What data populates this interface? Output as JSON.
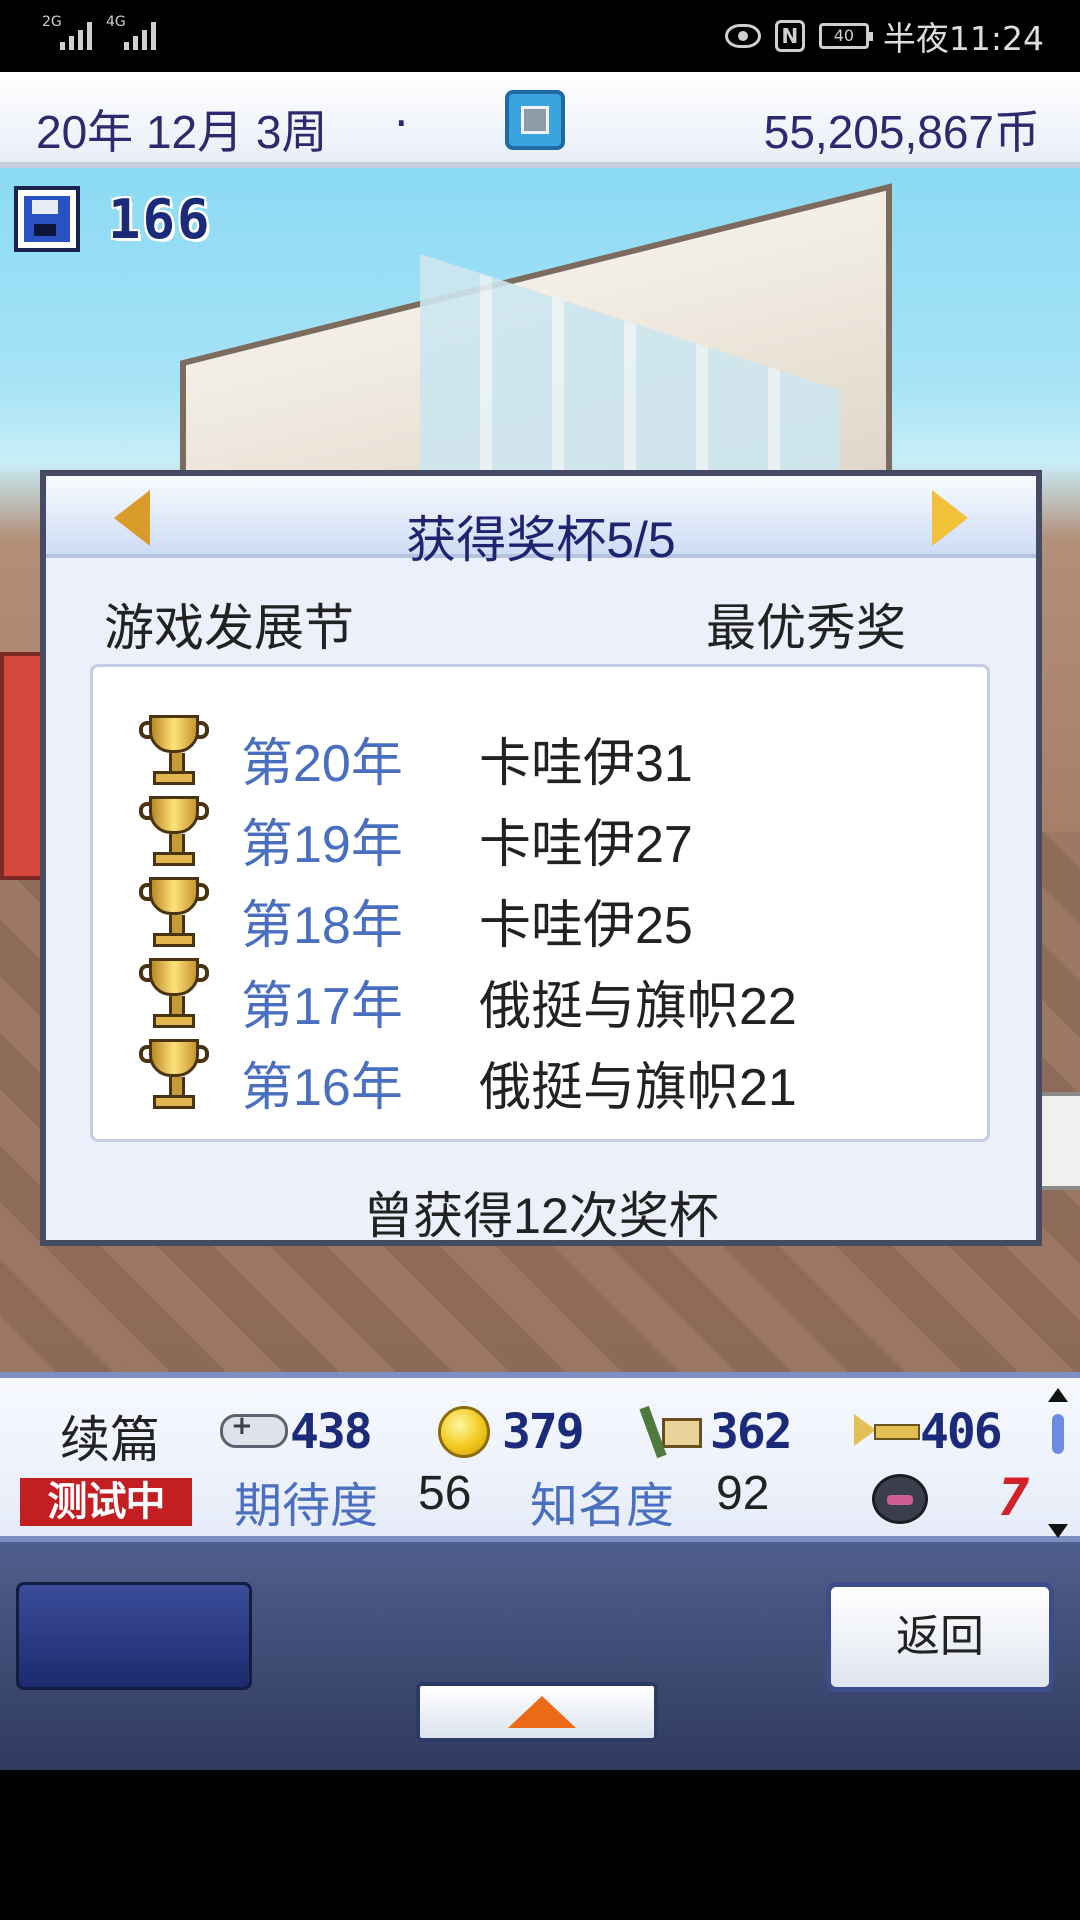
{
  "status_bar": {
    "signal1": "2G",
    "signal2": "4G",
    "battery": "40",
    "time": "半夜11:24"
  },
  "hud": {
    "date": "20年 12月 3周",
    "dot": "·",
    "money": "55,205,867币",
    "save_count": "166"
  },
  "dialog": {
    "title": "获得奖杯5/5",
    "event_name": "游戏发展节",
    "award_name": "最优秀奖",
    "trophies": [
      {
        "year": "第20年",
        "title": "卡哇伊31"
      },
      {
        "year": "第19年",
        "title": "卡哇伊27"
      },
      {
        "year": "第18年",
        "title": "卡哇伊25"
      },
      {
        "year": "第17年",
        "title": "俄挺与旗帜22"
      },
      {
        "year": "第16年",
        "title": "俄挺与旗帜21"
      }
    ],
    "total": "曾获得12次奖杯"
  },
  "info_panel": {
    "sequel_label": "续篇",
    "testing_badge": "测试中",
    "stats": {
      "fun": "438",
      "creativity": "379",
      "graphics": "362",
      "sound": "406"
    },
    "expectation_label": "期待度",
    "expectation_value": "56",
    "popularity_label": "知名度",
    "popularity_value": "92",
    "bug_count": "7"
  },
  "bottom_nav": {
    "back_label": "返回"
  }
}
